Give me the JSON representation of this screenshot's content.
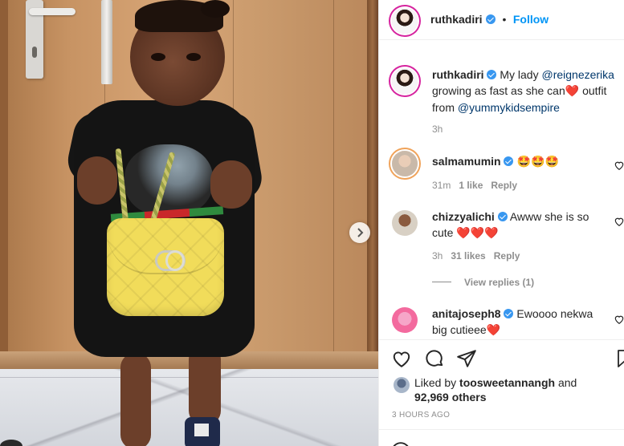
{
  "post": {
    "username": "ruthkadiri",
    "dot": "•",
    "follow_label": "Follow"
  },
  "caption": {
    "username": "ruthkadiri",
    "text_before": " My lady ",
    "mention1": "@reignezerika",
    "line2": "growing as fast as she can",
    "heart": "❤️",
    "line2_tail": " outfit",
    "line3_before": "from ",
    "mention2": "@yummykidsempire",
    "time": "3h"
  },
  "comments": [
    {
      "username": "salmamumin",
      "text": " 🤩🤩🤩",
      "time": "31m",
      "likes": "1 like",
      "reply": "Reply"
    },
    {
      "username": "chizzyalichi",
      "text": " Awww she is so",
      "text2": "cute ",
      "hearts": "❤️❤️❤️",
      "time": "3h",
      "likes": "31 likes",
      "reply": "Reply",
      "view_replies": "View replies (1)"
    },
    {
      "username": "anitajoseph8",
      "text": " Ewoooo nekwa",
      "text2": "big cutieee",
      "heart": "❤️"
    }
  ],
  "likes": {
    "prefix": "Liked by ",
    "user": "toosweetannangh",
    "and": " and",
    "count": "92,969 others"
  },
  "time_ago": "3 HOURS AGO",
  "icons": {
    "like": "heart-outline-icon",
    "comment": "comment-bubble-icon",
    "share": "paper-plane-icon",
    "save": "bookmark-icon",
    "next": "chevron-right-icon",
    "verified": "verified-badge-icon"
  },
  "colors": {
    "link": "#0095f6",
    "mention": "#00376b",
    "muted": "#8e8e8e",
    "verified": "#3897f0",
    "text": "#262626"
  }
}
